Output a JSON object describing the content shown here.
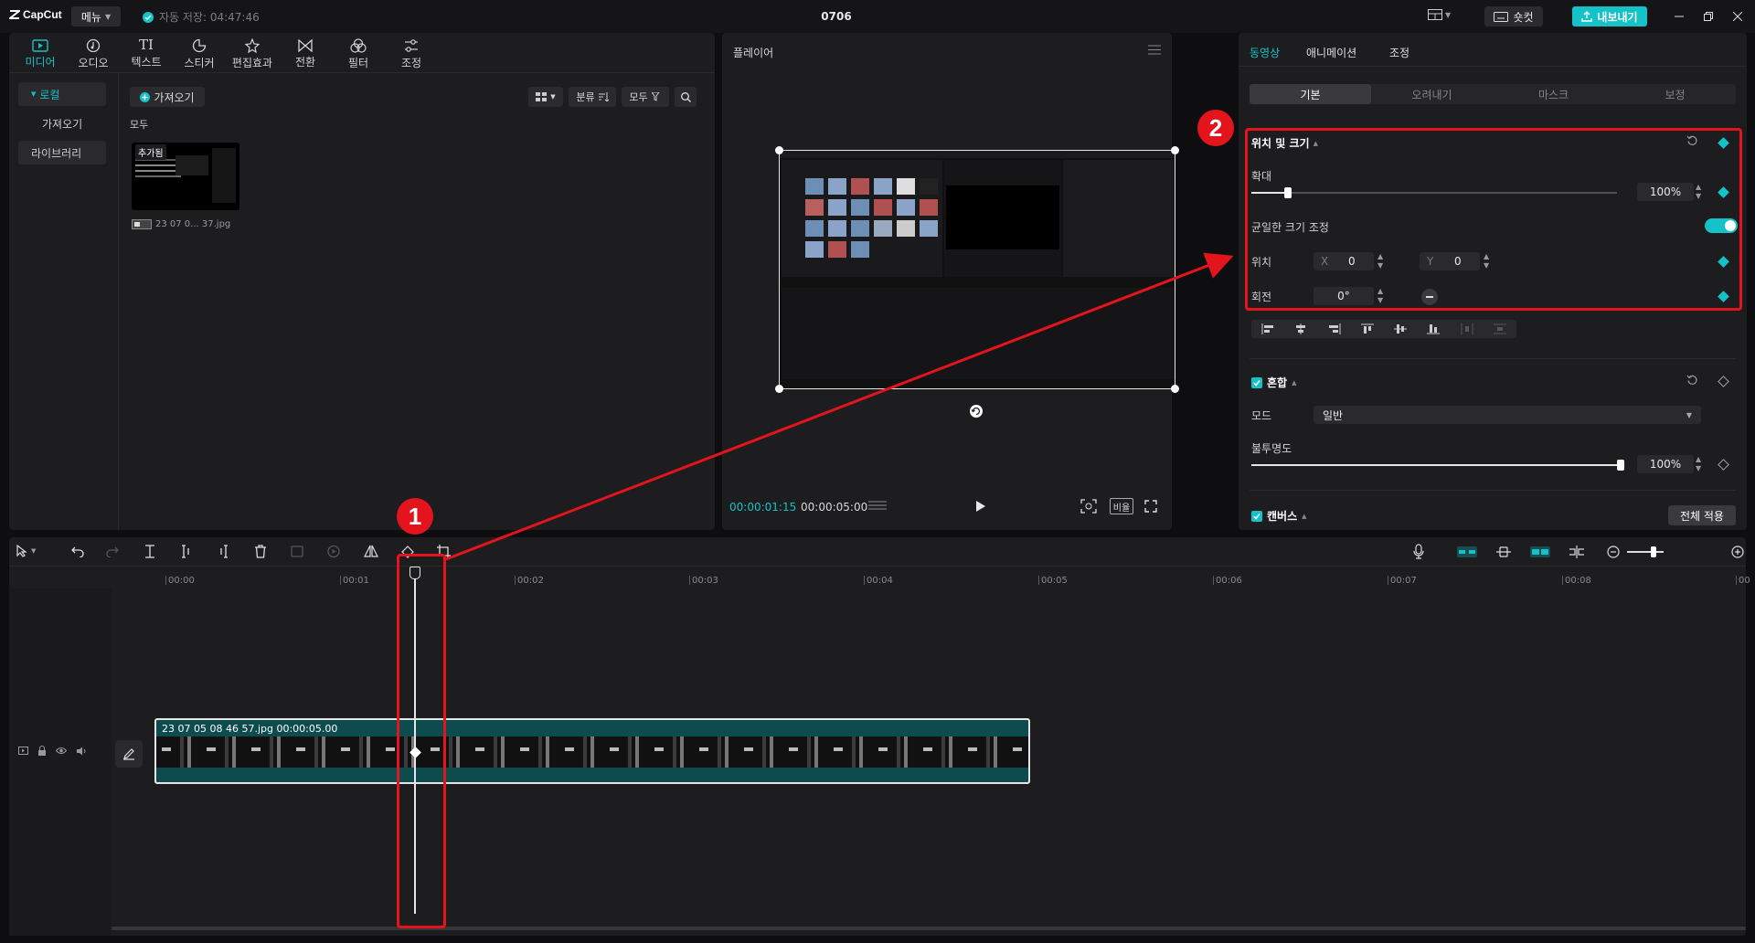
{
  "titlebar": {
    "logo": "CapCut",
    "menu_label": "메뉴",
    "autosave": "자동 저장: 04:47:46",
    "project_title": "0706",
    "shortcut_label": "숏컷",
    "export_label": "내보내기"
  },
  "media": {
    "tabs": [
      {
        "label": "미디어",
        "icon": "media-icon"
      },
      {
        "label": "오디오",
        "icon": "audio-icon"
      },
      {
        "label": "텍스트",
        "icon": "text-icon"
      },
      {
        "label": "스티커",
        "icon": "sticker-icon"
      },
      {
        "label": "편집효과",
        "icon": "effects-icon"
      },
      {
        "label": "전환",
        "icon": "transition-icon"
      },
      {
        "label": "필터",
        "icon": "filter-icon"
      },
      {
        "label": "조정",
        "icon": "adjust-icon"
      }
    ],
    "sidebar": [
      "로컬",
      "가져오기",
      "라이브러리"
    ],
    "import_label": "가져오기",
    "sort_label": "분류",
    "filter_label": "모두",
    "section_label": "모두",
    "thumb_badge": "추가됨",
    "file_name": "23 07 0... 37.jpg"
  },
  "player": {
    "title": "플레이어",
    "current_time": "00:00:01:15",
    "total_time": "00:00:05:00",
    "ratio_label": "비율"
  },
  "props": {
    "tabs": [
      "동영상",
      "애니메이션",
      "조정"
    ],
    "subtabs": [
      "기본",
      "오려내기",
      "마스크",
      "보정"
    ],
    "section_transform": "위치 및 크기",
    "scale_label": "확대",
    "scale_value": "100%",
    "scale_level": 0.1,
    "uniform_label": "균일한 크기 조정",
    "position_label": "위치",
    "x_label": "X",
    "x_value": "0",
    "y_label": "Y",
    "y_value": "0",
    "rotation_label": "회전",
    "rotation_value": "0°",
    "blend_section": "혼합",
    "mode_label": "모드",
    "mode_value": "일반",
    "opacity_label": "불투명도",
    "opacity_value": "100%",
    "opacity_level": 1.0,
    "canvas_section": "캔버스",
    "apply_all_label": "전체 적용"
  },
  "timeline": {
    "ticks": [
      "00:00",
      "00:01",
      "00:02",
      "00:03",
      "00:04",
      "00:05",
      "00:06",
      "00:07",
      "00:08",
      "00"
    ],
    "clip_label": "23 07 05 08 46 57.jpg  00:00:05.00"
  },
  "annotations": {
    "badge1": "1",
    "badge2": "2"
  },
  "colors": {
    "accent": "#14c2c7",
    "annotation_red": "#e3141b"
  }
}
